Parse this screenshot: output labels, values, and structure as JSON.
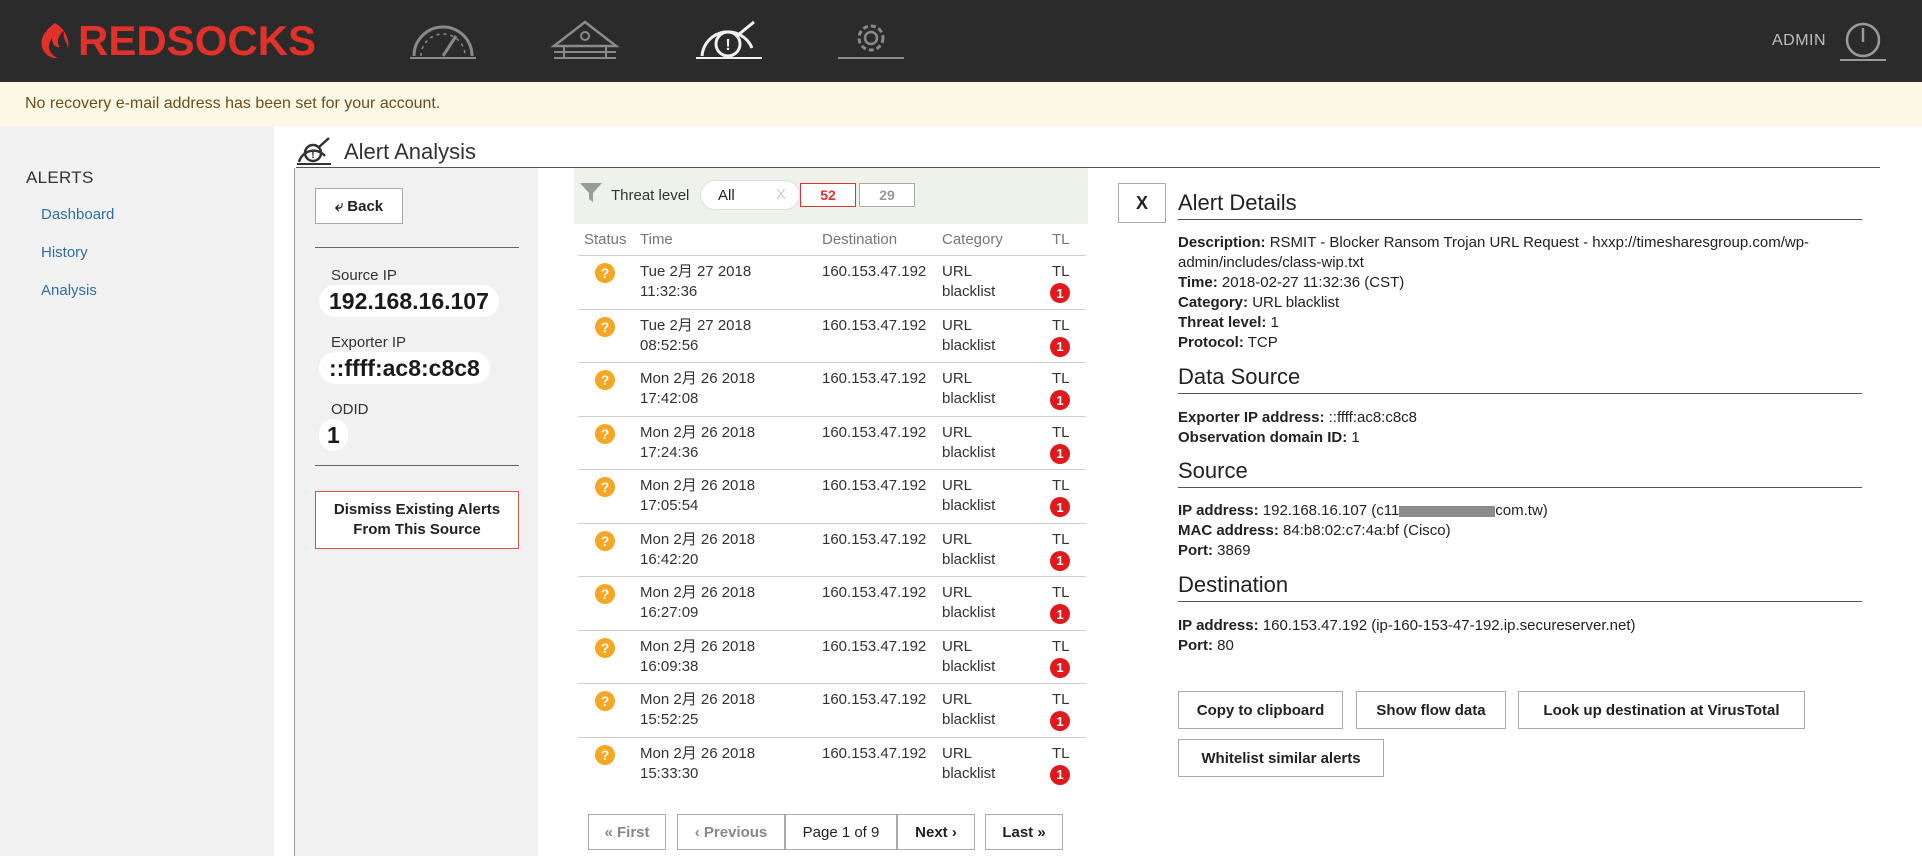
{
  "brand": {
    "name": "REDSOCKS",
    "color": "#e1312b"
  },
  "topbar": {
    "nav_icons": [
      "dashboard-gauge-icon",
      "network-icon",
      "alert-analysis-icon",
      "settings-gear-icon"
    ],
    "user": "ADMIN"
  },
  "banner": {
    "text": "No recovery e-mail address has been set for your account."
  },
  "sidebar": {
    "title": "ALERTS",
    "items": [
      {
        "label": "Dashboard"
      },
      {
        "label": "History"
      },
      {
        "label": "Analysis"
      }
    ]
  },
  "page": {
    "title": "Alert Analysis"
  },
  "source_panel": {
    "back_label": "Back",
    "source_ip_label": "Source IP",
    "source_ip": "192.168.16.107",
    "exporter_ip_label": "Exporter IP",
    "exporter_ip": "::ffff:ac8:c8c8",
    "odid_label": "ODID",
    "odid": "1",
    "dismiss_line1": "Dismiss Existing Alerts",
    "dismiss_line2": "From This Source"
  },
  "filter": {
    "label": "Threat level",
    "selected": "All",
    "clear": "X",
    "count_high": "52",
    "count_other": "29"
  },
  "alerts_table": {
    "columns": [
      "Status",
      "Time",
      "Destination",
      "Category",
      "TL"
    ],
    "rows": [
      {
        "date": "Tue 2月 27 2018",
        "time": "11:32:36",
        "destination": "160.153.47.192",
        "cat1": "URL",
        "cat2": "blacklist",
        "tl": "TL",
        "level": "1"
      },
      {
        "date": "Tue 2月 27 2018",
        "time": "08:52:56",
        "destination": "160.153.47.192",
        "cat1": "URL",
        "cat2": "blacklist",
        "tl": "TL",
        "level": "1"
      },
      {
        "date": "Mon 2月 26 2018",
        "time": "17:42:08",
        "destination": "160.153.47.192",
        "cat1": "URL",
        "cat2": "blacklist",
        "tl": "TL",
        "level": "1"
      },
      {
        "date": "Mon 2月 26 2018",
        "time": "17:24:36",
        "destination": "160.153.47.192",
        "cat1": "URL",
        "cat2": "blacklist",
        "tl": "TL",
        "level": "1"
      },
      {
        "date": "Mon 2月 26 2018",
        "time": "17:05:54",
        "destination": "160.153.47.192",
        "cat1": "URL",
        "cat2": "blacklist",
        "tl": "TL",
        "level": "1"
      },
      {
        "date": "Mon 2月 26 2018",
        "time": "16:42:20",
        "destination": "160.153.47.192",
        "cat1": "URL",
        "cat2": "blacklist",
        "tl": "TL",
        "level": "1"
      },
      {
        "date": "Mon 2月 26 2018",
        "time": "16:27:09",
        "destination": "160.153.47.192",
        "cat1": "URL",
        "cat2": "blacklist",
        "tl": "TL",
        "level": "1"
      },
      {
        "date": "Mon 2月 26 2018",
        "time": "16:09:38",
        "destination": "160.153.47.192",
        "cat1": "URL",
        "cat2": "blacklist",
        "tl": "TL",
        "level": "1"
      },
      {
        "date": "Mon 2月 26 2018",
        "time": "15:52:25",
        "destination": "160.153.47.192",
        "cat1": "URL",
        "cat2": "blacklist",
        "tl": "TL",
        "level": "1"
      },
      {
        "date": "Mon 2月 26 2018",
        "time": "15:33:30",
        "destination": "160.153.47.192",
        "cat1": "URL",
        "cat2": "blacklist",
        "tl": "TL",
        "level": "1"
      }
    ]
  },
  "pager": {
    "first": "« First",
    "previous": "‹ Previous",
    "page": "Page 1 of 9",
    "next": "Next ›",
    "last": "Last »"
  },
  "details": {
    "close": "X",
    "title": "Alert Details",
    "description_label": "Description:",
    "description": "RSMIT - Blocker Ransom Trojan URL Request - hxxp://timesharesgroup.com/wp-admin/includes/class-wip.txt",
    "time_label": "Time:",
    "time": "2018-02-27 11:32:36 (CST)",
    "category_label": "Category:",
    "category": "URL blacklist",
    "threat_label": "Threat level:",
    "threat": "1",
    "protocol_label": "Protocol:",
    "protocol": "TCP",
    "data_source_title": "Data Source",
    "exporter_label": "Exporter IP address:",
    "exporter": "::ffff:ac8:c8c8",
    "obs_label": "Observation domain ID:",
    "obs": "1",
    "source_title": "Source",
    "src_ip_label": "IP address:",
    "src_ip_prefix": "192.168.16.107 (c11",
    "src_ip_suffix": "com.tw)",
    "mac_label": "MAC address:",
    "mac": "84:b8:02:c7:4a:bf (Cisco)",
    "src_port_label": "Port:",
    "src_port": "3869",
    "destination_title": "Destination",
    "dst_ip_label": "IP address:",
    "dst_ip": "160.153.47.192 (ip-160-153-47-192.ip.secureserver.net)",
    "dst_port_label": "Port:",
    "dst_port": "80"
  },
  "actions": {
    "copy": "Copy to clipboard",
    "flow": "Show flow data",
    "virustotal": "Look up destination at VirusTotal",
    "whitelist": "Whitelist similar alerts"
  }
}
